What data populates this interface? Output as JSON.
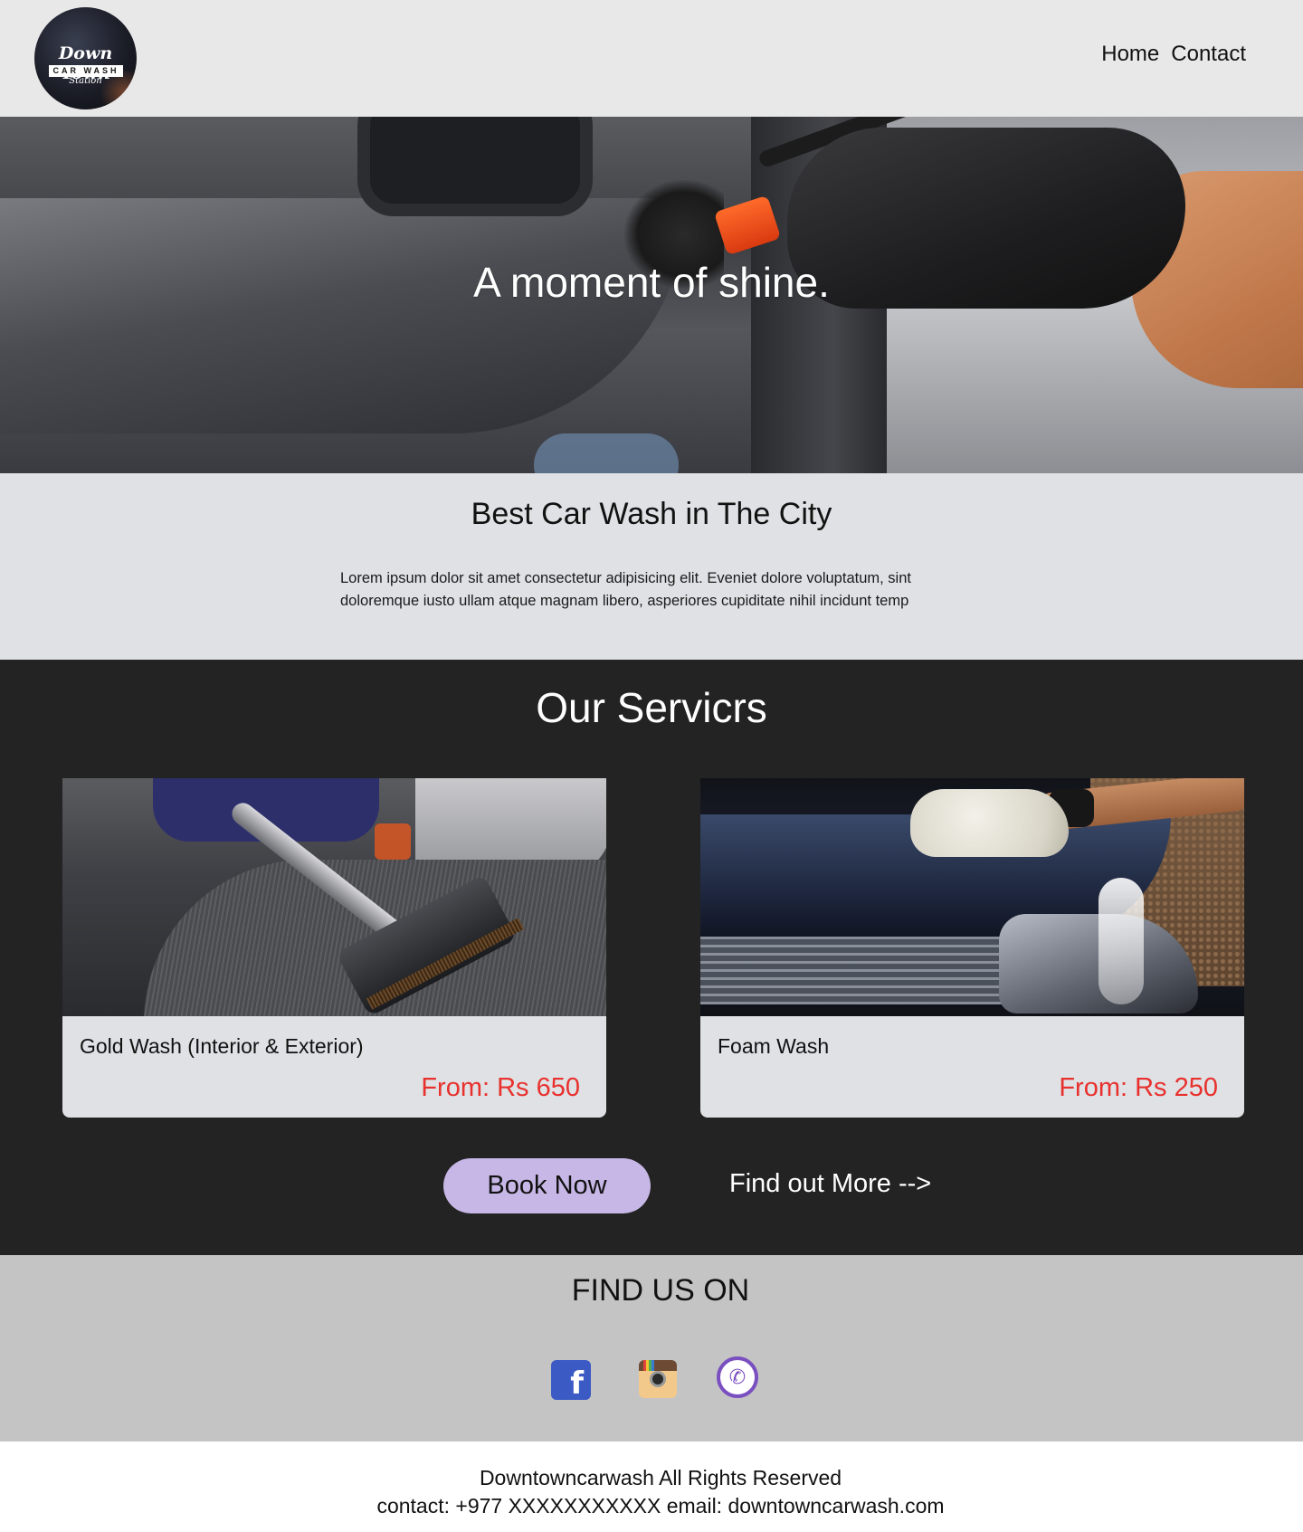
{
  "header": {
    "logo": {
      "line1": "Down Town",
      "band": "CAR WASH",
      "line3": "Station"
    },
    "nav": [
      {
        "label": "Home"
      },
      {
        "label": "Contact"
      }
    ]
  },
  "hero": {
    "title": "A moment of shine."
  },
  "about": {
    "heading": "Best Car Wash in The City",
    "text": "Lorem ipsum dolor sit amet consectetur adipisicing elit. Eveniet dolore voluptatum, sint doloremque iusto ullam atque magnam libero, asperiores cupiditate nihil incidunt temp"
  },
  "services": {
    "heading": "Our Servicrs",
    "cards": [
      {
        "name": "Gold Wash (Interior & Exterior)",
        "price": "From: Rs 650"
      },
      {
        "name": "Foam Wash",
        "price": "From: Rs 250"
      }
    ],
    "book_label": "Book Now",
    "more_label": "Find out More -->"
  },
  "social": {
    "heading": "FIND US ON",
    "icons": [
      "facebook-icon",
      "instagram-icon",
      "viber-icon"
    ]
  },
  "footer": {
    "line1": "Downtowncarwash All Rights Reserved",
    "line2": "contact: +977 XXXXXXXXXXX email: downtowncarwash.com"
  },
  "colors": {
    "header_bg": "#e8e8e8",
    "section_light": "#dfe1e4",
    "services_bg": "#232323",
    "price": "#e8312e",
    "book_button": "#c7b7e6",
    "social_bg": "#c4c4c5"
  }
}
